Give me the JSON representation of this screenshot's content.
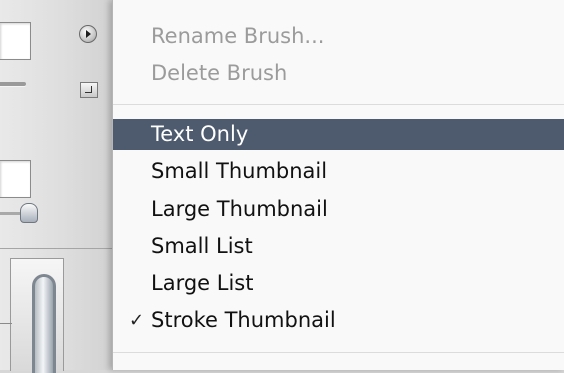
{
  "palette": {
    "flyout_icon": "triangle-right-icon",
    "new_preset_icon": "new-preset-icon",
    "preview_icon": "brush-preview"
  },
  "menu": {
    "group1": [
      {
        "label": "Rename Brush...",
        "enabled": false
      },
      {
        "label": "Delete Brush",
        "enabled": false
      }
    ],
    "group2": [
      {
        "label": "Text Only",
        "highlighted": true
      },
      {
        "label": "Small Thumbnail"
      },
      {
        "label": "Large Thumbnail"
      },
      {
        "label": "Small List"
      },
      {
        "label": "Large List"
      },
      {
        "label": "Stroke Thumbnail",
        "checked": true,
        "check_mark": "✓"
      }
    ]
  },
  "colors": {
    "highlight": "#4e5b6e",
    "disabled_text": "#9b9b9b",
    "menu_bg": "#fafafa"
  }
}
